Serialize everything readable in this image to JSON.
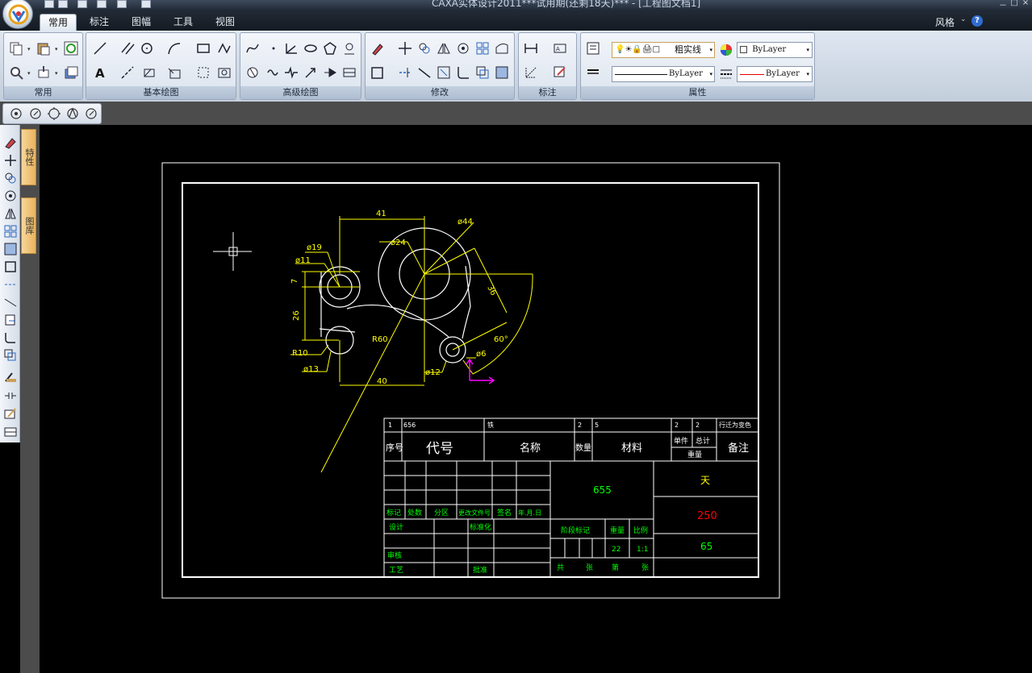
{
  "window": {
    "title": "CAXA实体设计2011***试用期(还剩18天)*** - [工程图文档1]",
    "minimize": "－",
    "restore": "□",
    "close": "×"
  },
  "app_button": {
    "icon": "caxa-logo-icon"
  },
  "tabs": [
    {
      "label": "常用",
      "active": true
    },
    {
      "label": "标注",
      "active": false
    },
    {
      "label": "图幅",
      "active": false
    },
    {
      "label": "工具",
      "active": false
    },
    {
      "label": "视图",
      "active": false
    }
  ],
  "right_menu": {
    "style_label": "风格",
    "help": "?"
  },
  "ribbon": {
    "groups": [
      {
        "label": "常用"
      },
      {
        "label": "基本绘图"
      },
      {
        "label": "高级绘图"
      },
      {
        "label": "修改"
      },
      {
        "label": "标注"
      },
      {
        "label": "属性"
      }
    ],
    "properties": {
      "layer_label": "粗实线",
      "color_value": "ByLayer",
      "linetype_value": "ByLayer",
      "lineweight_value": "ByLayer",
      "accent_red": "#e00000"
    }
  },
  "side_tabs": [
    {
      "label": "特性"
    },
    {
      "label": "图库"
    }
  ],
  "drawing": {
    "dims": {
      "d41": "41",
      "d44": "ø44",
      "d24": "ø24",
      "d19": "ø19",
      "d11": "ø11",
      "d7": "7",
      "d26": "26",
      "d36": "36",
      "r60": "R60",
      "r10": "R10",
      "d13": "ø13",
      "d40": "40",
      "d12": "ø12",
      "d6": "ø6",
      "a60": "60°"
    },
    "colors": {
      "geometry": "#ffffff",
      "dimension": "#ffff00",
      "frame": "#ffffff",
      "green_text": "#00ff00",
      "red_text": "#ff0000",
      "ucs": "#ff00ff"
    }
  },
  "title_block": {
    "bom_row": [
      "1",
      "656",
      "铁",
      "2",
      "5",
      "2",
      "2",
      "行迁为变色"
    ],
    "header": [
      "序号",
      "代号",
      "名称",
      "数量",
      "材料",
      "单件",
      "总计",
      "重量",
      "备注"
    ],
    "center_value": "655",
    "right_values": [
      "天",
      "250",
      "65"
    ],
    "row_labels": [
      "标记",
      "处数",
      "分区",
      "更改文件号",
      "签名",
      "年.月.日"
    ],
    "design": "设计",
    "standardize": "标准化",
    "stage_mark": "阶段标记",
    "weight": "重量",
    "scale": "比例",
    "weight_value": "22",
    "scale_value": "1:1",
    "review": "审核",
    "process": "工艺",
    "approve": "批准",
    "sheet_text": [
      "共",
      "张",
      "第",
      "张"
    ]
  }
}
